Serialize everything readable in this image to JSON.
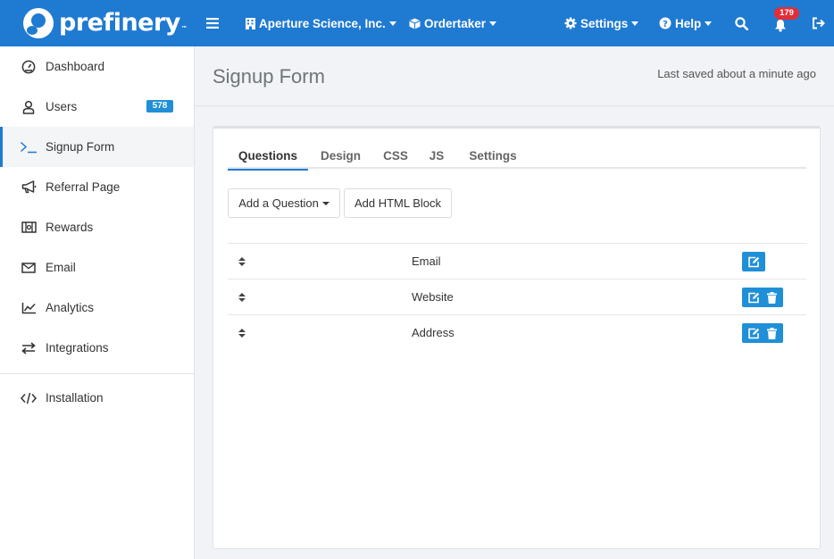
{
  "brand": {
    "name": "prefinery",
    "tm": "™"
  },
  "topbar": {
    "menu_icon": "hamburger-icon",
    "company": "Aperture Science, Inc.",
    "project": "Ordertaker",
    "settings": "Settings",
    "help": "Help",
    "notifications_count": "179"
  },
  "sidebar": {
    "items": [
      {
        "label": "Dashboard",
        "icon": "dashboard-icon"
      },
      {
        "label": "Users",
        "icon": "user-icon",
        "badge": "578"
      },
      {
        "label": "Signup Form",
        "icon": "terminal-icon",
        "active": true
      },
      {
        "label": "Referral Page",
        "icon": "megaphone-icon"
      },
      {
        "label": "Rewards",
        "icon": "rewards-icon"
      },
      {
        "label": "Email",
        "icon": "envelope-icon"
      },
      {
        "label": "Analytics",
        "icon": "chart-icon"
      },
      {
        "label": "Integrations",
        "icon": "exchange-icon"
      },
      {
        "label": "Installation",
        "icon": "code-icon"
      }
    ]
  },
  "page": {
    "title": "Signup Form",
    "saved_status": "Last saved about a minute ago"
  },
  "tabs": [
    {
      "label": "Questions",
      "active": true
    },
    {
      "label": "Design"
    },
    {
      "label": "CSS"
    },
    {
      "label": "JS"
    },
    {
      "label": "Settings"
    }
  ],
  "buttons": {
    "add_question": "Add a Question",
    "add_html_block": "Add HTML Block"
  },
  "questions": [
    {
      "name": "Email",
      "deletable": false
    },
    {
      "name": "Website",
      "deletable": true
    },
    {
      "name": "Address",
      "deletable": true
    }
  ],
  "colors": {
    "primary": "#1f7ad1",
    "action_button": "#1f8fd8",
    "badge_red": "#e32d36"
  }
}
